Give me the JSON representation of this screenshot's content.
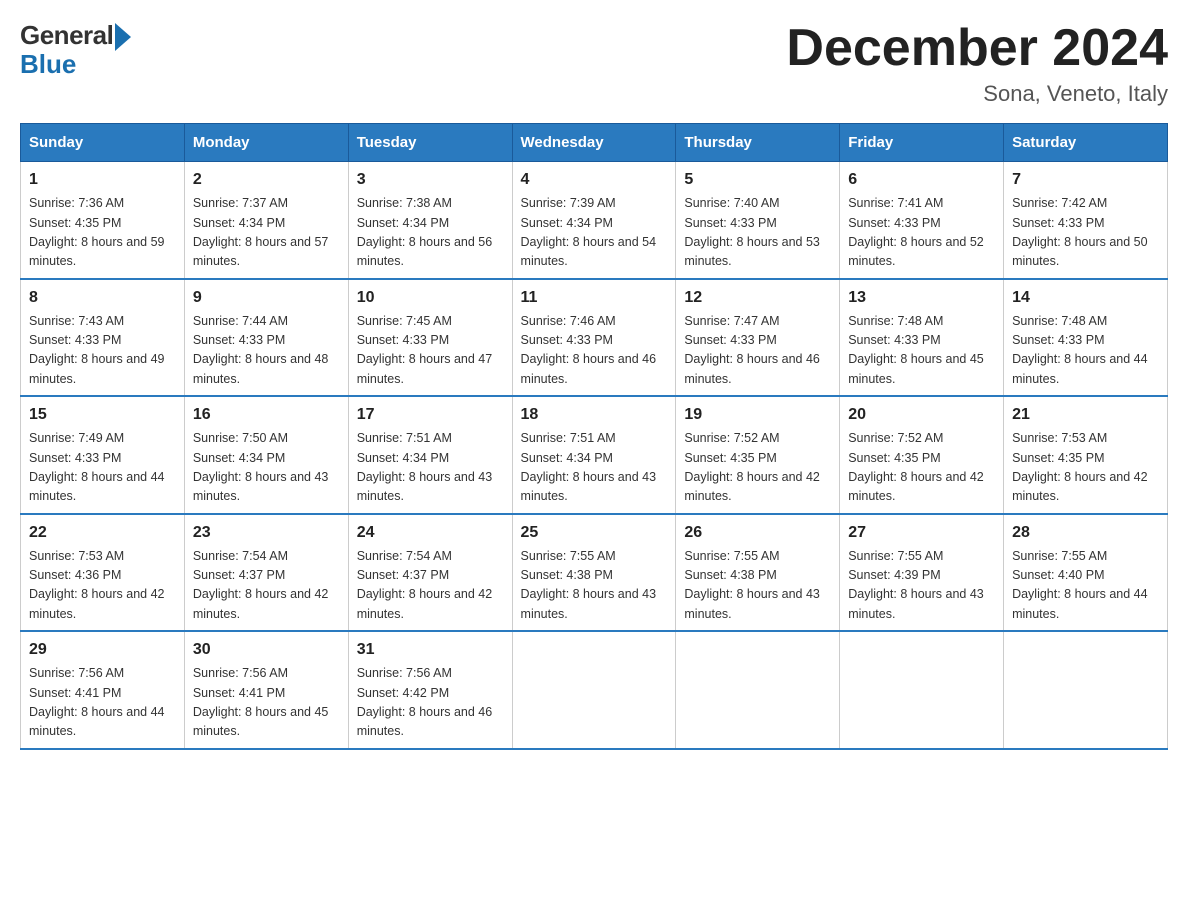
{
  "header": {
    "logo_general": "General",
    "logo_blue": "Blue",
    "month_title": "December 2024",
    "location": "Sona, Veneto, Italy"
  },
  "days_of_week": [
    "Sunday",
    "Monday",
    "Tuesday",
    "Wednesday",
    "Thursday",
    "Friday",
    "Saturday"
  ],
  "weeks": [
    [
      {
        "day": "1",
        "sunrise": "7:36 AM",
        "sunset": "4:35 PM",
        "daylight": "8 hours and 59 minutes."
      },
      {
        "day": "2",
        "sunrise": "7:37 AM",
        "sunset": "4:34 PM",
        "daylight": "8 hours and 57 minutes."
      },
      {
        "day": "3",
        "sunrise": "7:38 AM",
        "sunset": "4:34 PM",
        "daylight": "8 hours and 56 minutes."
      },
      {
        "day": "4",
        "sunrise": "7:39 AM",
        "sunset": "4:34 PM",
        "daylight": "8 hours and 54 minutes."
      },
      {
        "day": "5",
        "sunrise": "7:40 AM",
        "sunset": "4:33 PM",
        "daylight": "8 hours and 53 minutes."
      },
      {
        "day": "6",
        "sunrise": "7:41 AM",
        "sunset": "4:33 PM",
        "daylight": "8 hours and 52 minutes."
      },
      {
        "day": "7",
        "sunrise": "7:42 AM",
        "sunset": "4:33 PM",
        "daylight": "8 hours and 50 minutes."
      }
    ],
    [
      {
        "day": "8",
        "sunrise": "7:43 AM",
        "sunset": "4:33 PM",
        "daylight": "8 hours and 49 minutes."
      },
      {
        "day": "9",
        "sunrise": "7:44 AM",
        "sunset": "4:33 PM",
        "daylight": "8 hours and 48 minutes."
      },
      {
        "day": "10",
        "sunrise": "7:45 AM",
        "sunset": "4:33 PM",
        "daylight": "8 hours and 47 minutes."
      },
      {
        "day": "11",
        "sunrise": "7:46 AM",
        "sunset": "4:33 PM",
        "daylight": "8 hours and 46 minutes."
      },
      {
        "day": "12",
        "sunrise": "7:47 AM",
        "sunset": "4:33 PM",
        "daylight": "8 hours and 46 minutes."
      },
      {
        "day": "13",
        "sunrise": "7:48 AM",
        "sunset": "4:33 PM",
        "daylight": "8 hours and 45 minutes."
      },
      {
        "day": "14",
        "sunrise": "7:48 AM",
        "sunset": "4:33 PM",
        "daylight": "8 hours and 44 minutes."
      }
    ],
    [
      {
        "day": "15",
        "sunrise": "7:49 AM",
        "sunset": "4:33 PM",
        "daylight": "8 hours and 44 minutes."
      },
      {
        "day": "16",
        "sunrise": "7:50 AM",
        "sunset": "4:34 PM",
        "daylight": "8 hours and 43 minutes."
      },
      {
        "day": "17",
        "sunrise": "7:51 AM",
        "sunset": "4:34 PM",
        "daylight": "8 hours and 43 minutes."
      },
      {
        "day": "18",
        "sunrise": "7:51 AM",
        "sunset": "4:34 PM",
        "daylight": "8 hours and 43 minutes."
      },
      {
        "day": "19",
        "sunrise": "7:52 AM",
        "sunset": "4:35 PM",
        "daylight": "8 hours and 42 minutes."
      },
      {
        "day": "20",
        "sunrise": "7:52 AM",
        "sunset": "4:35 PM",
        "daylight": "8 hours and 42 minutes."
      },
      {
        "day": "21",
        "sunrise": "7:53 AM",
        "sunset": "4:35 PM",
        "daylight": "8 hours and 42 minutes."
      }
    ],
    [
      {
        "day": "22",
        "sunrise": "7:53 AM",
        "sunset": "4:36 PM",
        "daylight": "8 hours and 42 minutes."
      },
      {
        "day": "23",
        "sunrise": "7:54 AM",
        "sunset": "4:37 PM",
        "daylight": "8 hours and 42 minutes."
      },
      {
        "day": "24",
        "sunrise": "7:54 AM",
        "sunset": "4:37 PM",
        "daylight": "8 hours and 42 minutes."
      },
      {
        "day": "25",
        "sunrise": "7:55 AM",
        "sunset": "4:38 PM",
        "daylight": "8 hours and 43 minutes."
      },
      {
        "day": "26",
        "sunrise": "7:55 AM",
        "sunset": "4:38 PM",
        "daylight": "8 hours and 43 minutes."
      },
      {
        "day": "27",
        "sunrise": "7:55 AM",
        "sunset": "4:39 PM",
        "daylight": "8 hours and 43 minutes."
      },
      {
        "day": "28",
        "sunrise": "7:55 AM",
        "sunset": "4:40 PM",
        "daylight": "8 hours and 44 minutes."
      }
    ],
    [
      {
        "day": "29",
        "sunrise": "7:56 AM",
        "sunset": "4:41 PM",
        "daylight": "8 hours and 44 minutes."
      },
      {
        "day": "30",
        "sunrise": "7:56 AM",
        "sunset": "4:41 PM",
        "daylight": "8 hours and 45 minutes."
      },
      {
        "day": "31",
        "sunrise": "7:56 AM",
        "sunset": "4:42 PM",
        "daylight": "8 hours and 46 minutes."
      },
      null,
      null,
      null,
      null
    ]
  ],
  "labels": {
    "sunrise_prefix": "Sunrise: ",
    "sunset_prefix": "Sunset: ",
    "daylight_prefix": "Daylight: "
  }
}
